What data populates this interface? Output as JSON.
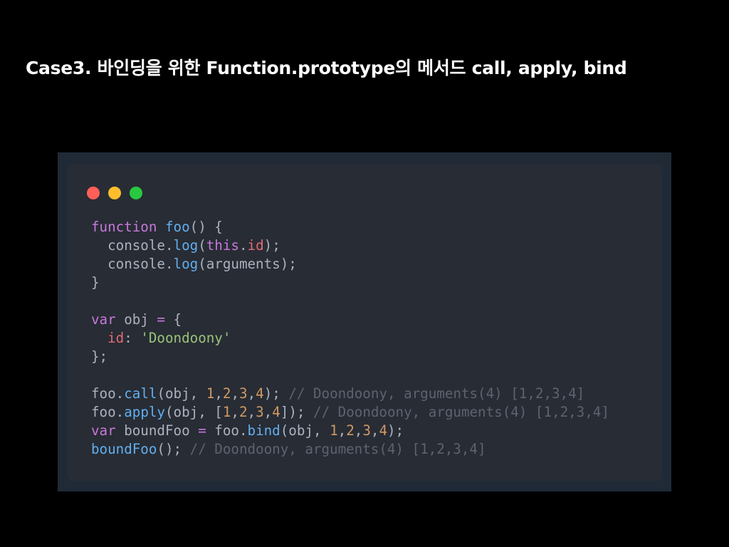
{
  "slide": {
    "title": "Case3. 바인딩을 위한 Function.prototype의 메서드 call, apply, bind"
  },
  "code_window": {
    "colors": {
      "background": "#282c34",
      "frame": "#1f2a36",
      "red_light": "#ff5f58",
      "yellow_light": "#ffbd2e",
      "green_light": "#28c840"
    },
    "lines": [
      [
        {
          "t": "function",
          "c": "kw"
        },
        {
          "t": " ",
          "c": "pl"
        },
        {
          "t": "foo",
          "c": "fn"
        },
        {
          "t": "() {",
          "c": "pl"
        }
      ],
      [
        {
          "t": "  console",
          "c": "pl"
        },
        {
          "t": ".",
          "c": "pl"
        },
        {
          "t": "log",
          "c": "fn"
        },
        {
          "t": "(",
          "c": "pl"
        },
        {
          "t": "this",
          "c": "kw"
        },
        {
          "t": ".",
          "c": "pl"
        },
        {
          "t": "id",
          "c": "prop"
        },
        {
          "t": ");",
          "c": "pl"
        }
      ],
      [
        {
          "t": "  console",
          "c": "pl"
        },
        {
          "t": ".",
          "c": "pl"
        },
        {
          "t": "log",
          "c": "fn"
        },
        {
          "t": "(arguments);",
          "c": "pl"
        }
      ],
      [
        {
          "t": "}",
          "c": "pl"
        }
      ],
      [],
      [
        {
          "t": "var",
          "c": "kw"
        },
        {
          "t": " obj ",
          "c": "pl"
        },
        {
          "t": "=",
          "c": "kw"
        },
        {
          "t": " {",
          "c": "pl"
        }
      ],
      [
        {
          "t": "  ",
          "c": "pl"
        },
        {
          "t": "id",
          "c": "prop"
        },
        {
          "t": ": ",
          "c": "pl"
        },
        {
          "t": "'Doondoony'",
          "c": "str"
        }
      ],
      [
        {
          "t": "};",
          "c": "pl"
        }
      ],
      [],
      [
        {
          "t": "foo",
          "c": "pl"
        },
        {
          "t": ".",
          "c": "pl"
        },
        {
          "t": "call",
          "c": "fn"
        },
        {
          "t": "(obj, ",
          "c": "pl"
        },
        {
          "t": "1",
          "c": "num"
        },
        {
          "t": ",",
          "c": "pl"
        },
        {
          "t": "2",
          "c": "num"
        },
        {
          "t": ",",
          "c": "pl"
        },
        {
          "t": "3",
          "c": "num"
        },
        {
          "t": ",",
          "c": "pl"
        },
        {
          "t": "4",
          "c": "num"
        },
        {
          "t": "); ",
          "c": "pl"
        },
        {
          "t": "// Doondoony, arguments(4) [1,2,3,4]",
          "c": "cmt"
        }
      ],
      [
        {
          "t": "foo",
          "c": "pl"
        },
        {
          "t": ".",
          "c": "pl"
        },
        {
          "t": "apply",
          "c": "fn"
        },
        {
          "t": "(obj, [",
          "c": "pl"
        },
        {
          "t": "1",
          "c": "num"
        },
        {
          "t": ",",
          "c": "pl"
        },
        {
          "t": "2",
          "c": "num"
        },
        {
          "t": ",",
          "c": "pl"
        },
        {
          "t": "3",
          "c": "num"
        },
        {
          "t": ",",
          "c": "pl"
        },
        {
          "t": "4",
          "c": "num"
        },
        {
          "t": "]); ",
          "c": "pl"
        },
        {
          "t": "// Doondoony, arguments(4) [1,2,3,4]",
          "c": "cmt"
        }
      ],
      [
        {
          "t": "var",
          "c": "kw"
        },
        {
          "t": " boundFoo ",
          "c": "pl"
        },
        {
          "t": "=",
          "c": "kw"
        },
        {
          "t": " foo",
          "c": "pl"
        },
        {
          "t": ".",
          "c": "pl"
        },
        {
          "t": "bind",
          "c": "fn"
        },
        {
          "t": "(obj, ",
          "c": "pl"
        },
        {
          "t": "1",
          "c": "num"
        },
        {
          "t": ",",
          "c": "pl"
        },
        {
          "t": "2",
          "c": "num"
        },
        {
          "t": ",",
          "c": "pl"
        },
        {
          "t": "3",
          "c": "num"
        },
        {
          "t": ",",
          "c": "pl"
        },
        {
          "t": "4",
          "c": "num"
        },
        {
          "t": ");",
          "c": "pl"
        }
      ],
      [
        {
          "t": "boundFoo",
          "c": "fn"
        },
        {
          "t": "(); ",
          "c": "pl"
        },
        {
          "t": "// Doondoony, arguments(4) [1,2,3,4]",
          "c": "cmt"
        }
      ]
    ]
  }
}
